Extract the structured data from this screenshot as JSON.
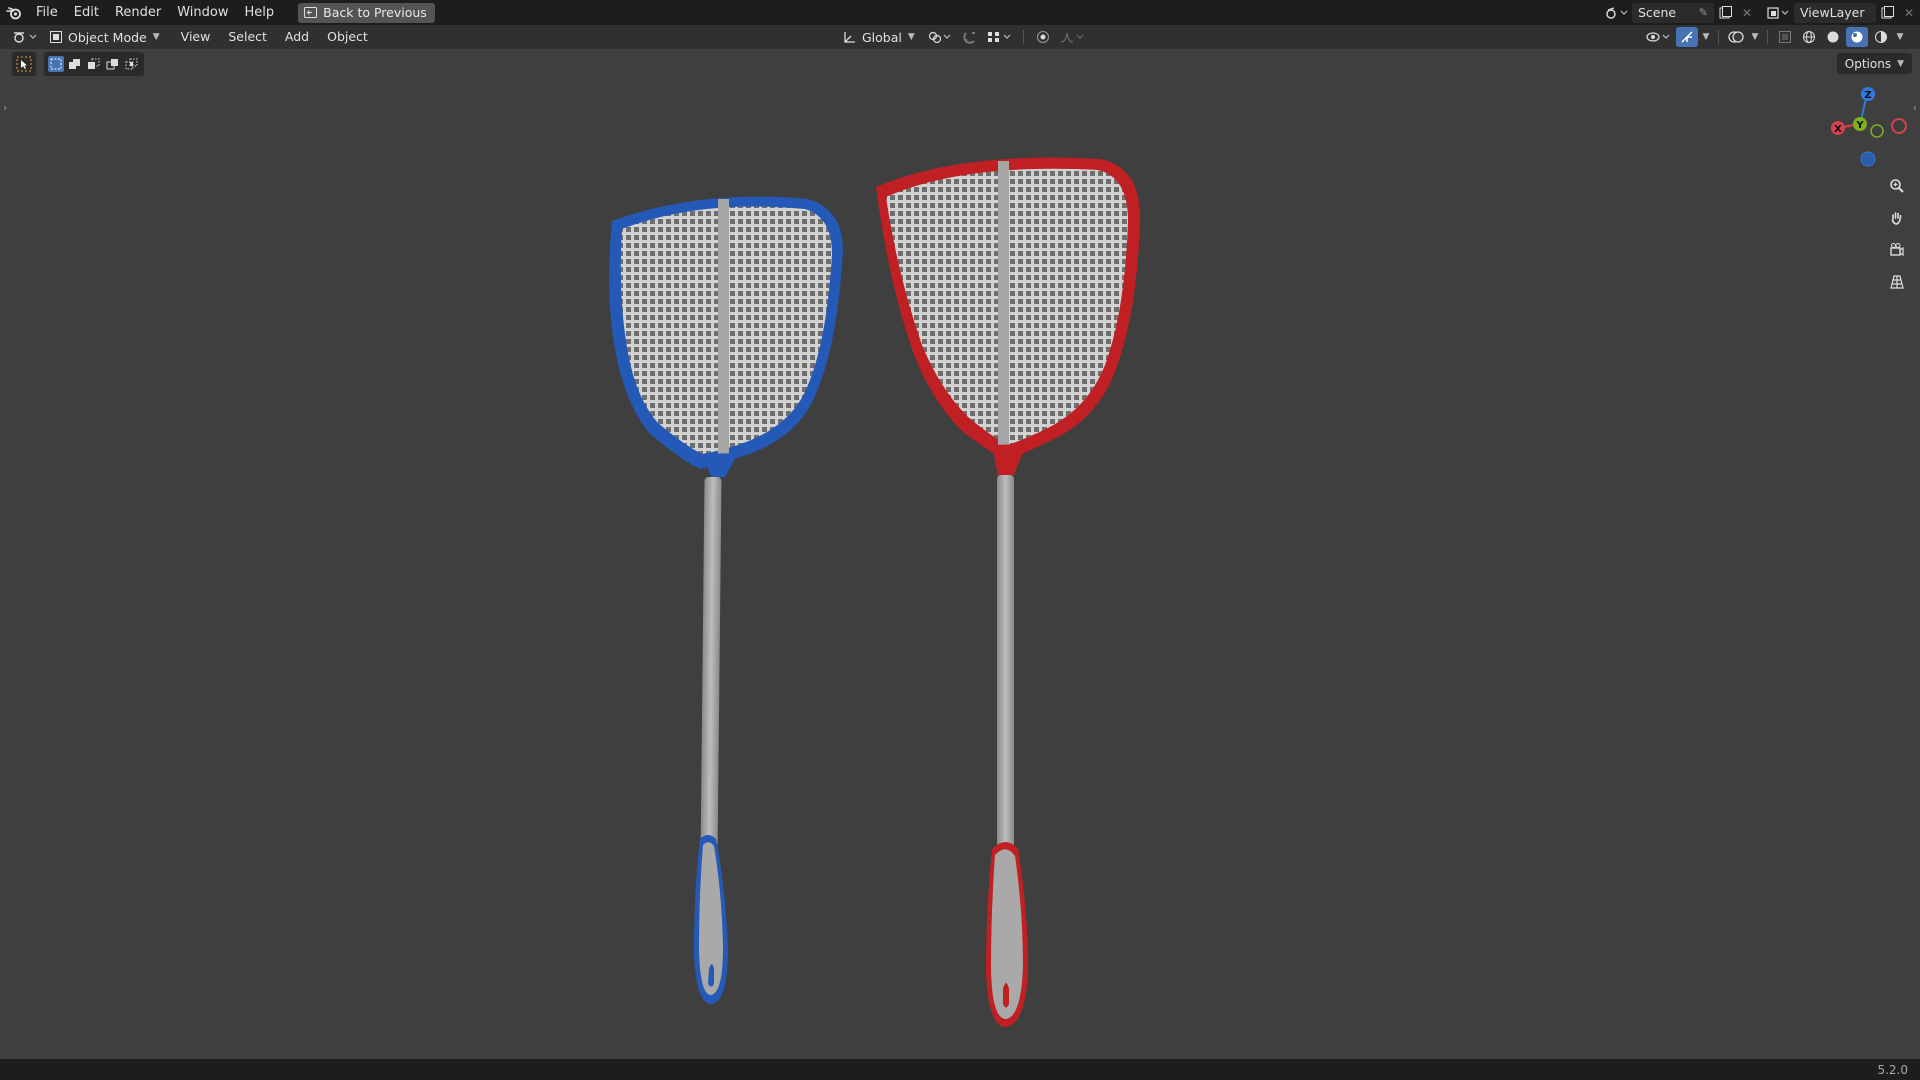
{
  "menu": {
    "items": [
      "File",
      "Edit",
      "Render",
      "Window",
      "Help"
    ],
    "back_button": "Back to Previous"
  },
  "topbar_right": {
    "scene": "Scene",
    "view_layer": "ViewLayer"
  },
  "header": {
    "mode": "Object Mode",
    "menus": [
      "View",
      "Select",
      "Add",
      "Object"
    ],
    "transform_orientation": "Global",
    "options": "Options"
  },
  "gizmo": {
    "z": "Z",
    "y": "Y",
    "x": "X"
  },
  "status": {
    "version": "5.2.0"
  },
  "colors": {
    "blue_swatter": "#2459b8",
    "red_swatter": "#c01f24",
    "handle": "#a9a9a9",
    "axis_x": "#d6404f",
    "axis_y": "#7cb01c",
    "axis_z": "#2f7ae0"
  }
}
